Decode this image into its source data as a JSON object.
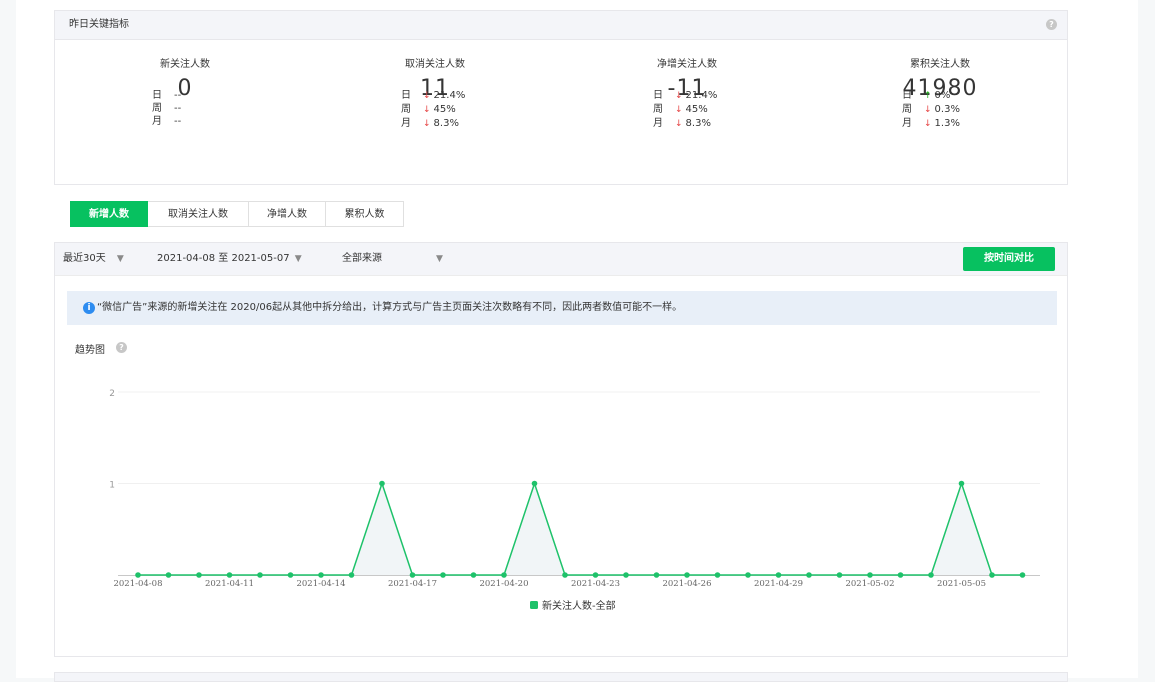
{
  "kpi": {
    "header": "昨日关键指标",
    "help_icon": "question-circle-icon",
    "cards": [
      {
        "title": "新关注人数",
        "value": "0",
        "rows": [
          {
            "label": "日",
            "dir": "",
            "value": "--"
          },
          {
            "label": "周",
            "dir": "",
            "value": "--"
          },
          {
            "label": "月",
            "dir": "",
            "value": "--"
          }
        ]
      },
      {
        "title": "取消关注人数",
        "value": "11",
        "rows": [
          {
            "label": "日",
            "dir": "down",
            "value": "21.4%"
          },
          {
            "label": "周",
            "dir": "down",
            "value": "45%"
          },
          {
            "label": "月",
            "dir": "down",
            "value": "8.3%"
          }
        ]
      },
      {
        "title": "净增关注人数",
        "value": "-11",
        "rows": [
          {
            "label": "日",
            "dir": "down",
            "value": "21.4%"
          },
          {
            "label": "周",
            "dir": "down",
            "value": "45%"
          },
          {
            "label": "月",
            "dir": "down",
            "value": "8.3%"
          }
        ]
      },
      {
        "title": "累积关注人数",
        "value": "41980",
        "rows": [
          {
            "label": "日",
            "dir": "up",
            "value": "0%"
          },
          {
            "label": "周",
            "dir": "down",
            "value": "0.3%"
          },
          {
            "label": "月",
            "dir": "down",
            "value": "1.3%"
          }
        ]
      }
    ]
  },
  "tabs": [
    {
      "label": "新增人数",
      "active": true
    },
    {
      "label": "取消关注人数",
      "active": false
    },
    {
      "label": "净增人数",
      "active": false
    },
    {
      "label": "累积人数",
      "active": false
    }
  ],
  "filters": {
    "period": "最近30天",
    "range": "2021-04-08 至 2021-05-07",
    "source": "全部来源",
    "dropdown_icon": "triangle-down-icon",
    "compare_button": "按时间对比"
  },
  "notice": {
    "icon": "info-icon",
    "text": "“微信广告”来源的新增关注在 2020/06起从其他中拆分给出，计算方式与广告主页面关注次数略有不同，因此两者数值可能不一样。"
  },
  "trend": {
    "title": "趋势图",
    "help_icon": "question-circle-icon"
  },
  "colors": {
    "accent": "#07c160",
    "line": "#1ec26a",
    "down": "#e54545",
    "up": "#1aad19",
    "notice_bg": "#e8eff8"
  },
  "chart_data": {
    "type": "line",
    "x": [
      "2021-04-08",
      "2021-04-09",
      "2021-04-10",
      "2021-04-11",
      "2021-04-12",
      "2021-04-13",
      "2021-04-14",
      "2021-04-15",
      "2021-04-16",
      "2021-04-17",
      "2021-04-18",
      "2021-04-19",
      "2021-04-20",
      "2021-04-21",
      "2021-04-22",
      "2021-04-23",
      "2021-04-24",
      "2021-04-25",
      "2021-04-26",
      "2021-04-27",
      "2021-04-28",
      "2021-04-29",
      "2021-04-30",
      "2021-05-01",
      "2021-05-02",
      "2021-05-03",
      "2021-05-04",
      "2021-05-05",
      "2021-05-06",
      "2021-05-07"
    ],
    "x_ticks": [
      "2021-04-08",
      "2021-04-11",
      "2021-04-14",
      "2021-04-17",
      "2021-04-20",
      "2021-04-23",
      "2021-04-26",
      "2021-04-29",
      "2021-05-02",
      "2021-05-05"
    ],
    "series": [
      {
        "name": "新关注人数-全部",
        "values": [
          0,
          0,
          0,
          0,
          0,
          0,
          0,
          0,
          1,
          0,
          0,
          0,
          0,
          1,
          0,
          0,
          0,
          0,
          0,
          0,
          0,
          0,
          0,
          0,
          0,
          0,
          0,
          1,
          0,
          0
        ]
      }
    ],
    "y_ticks": [
      1,
      2
    ],
    "ylim": [
      0,
      2
    ],
    "grid": true,
    "legend": "bottom"
  }
}
